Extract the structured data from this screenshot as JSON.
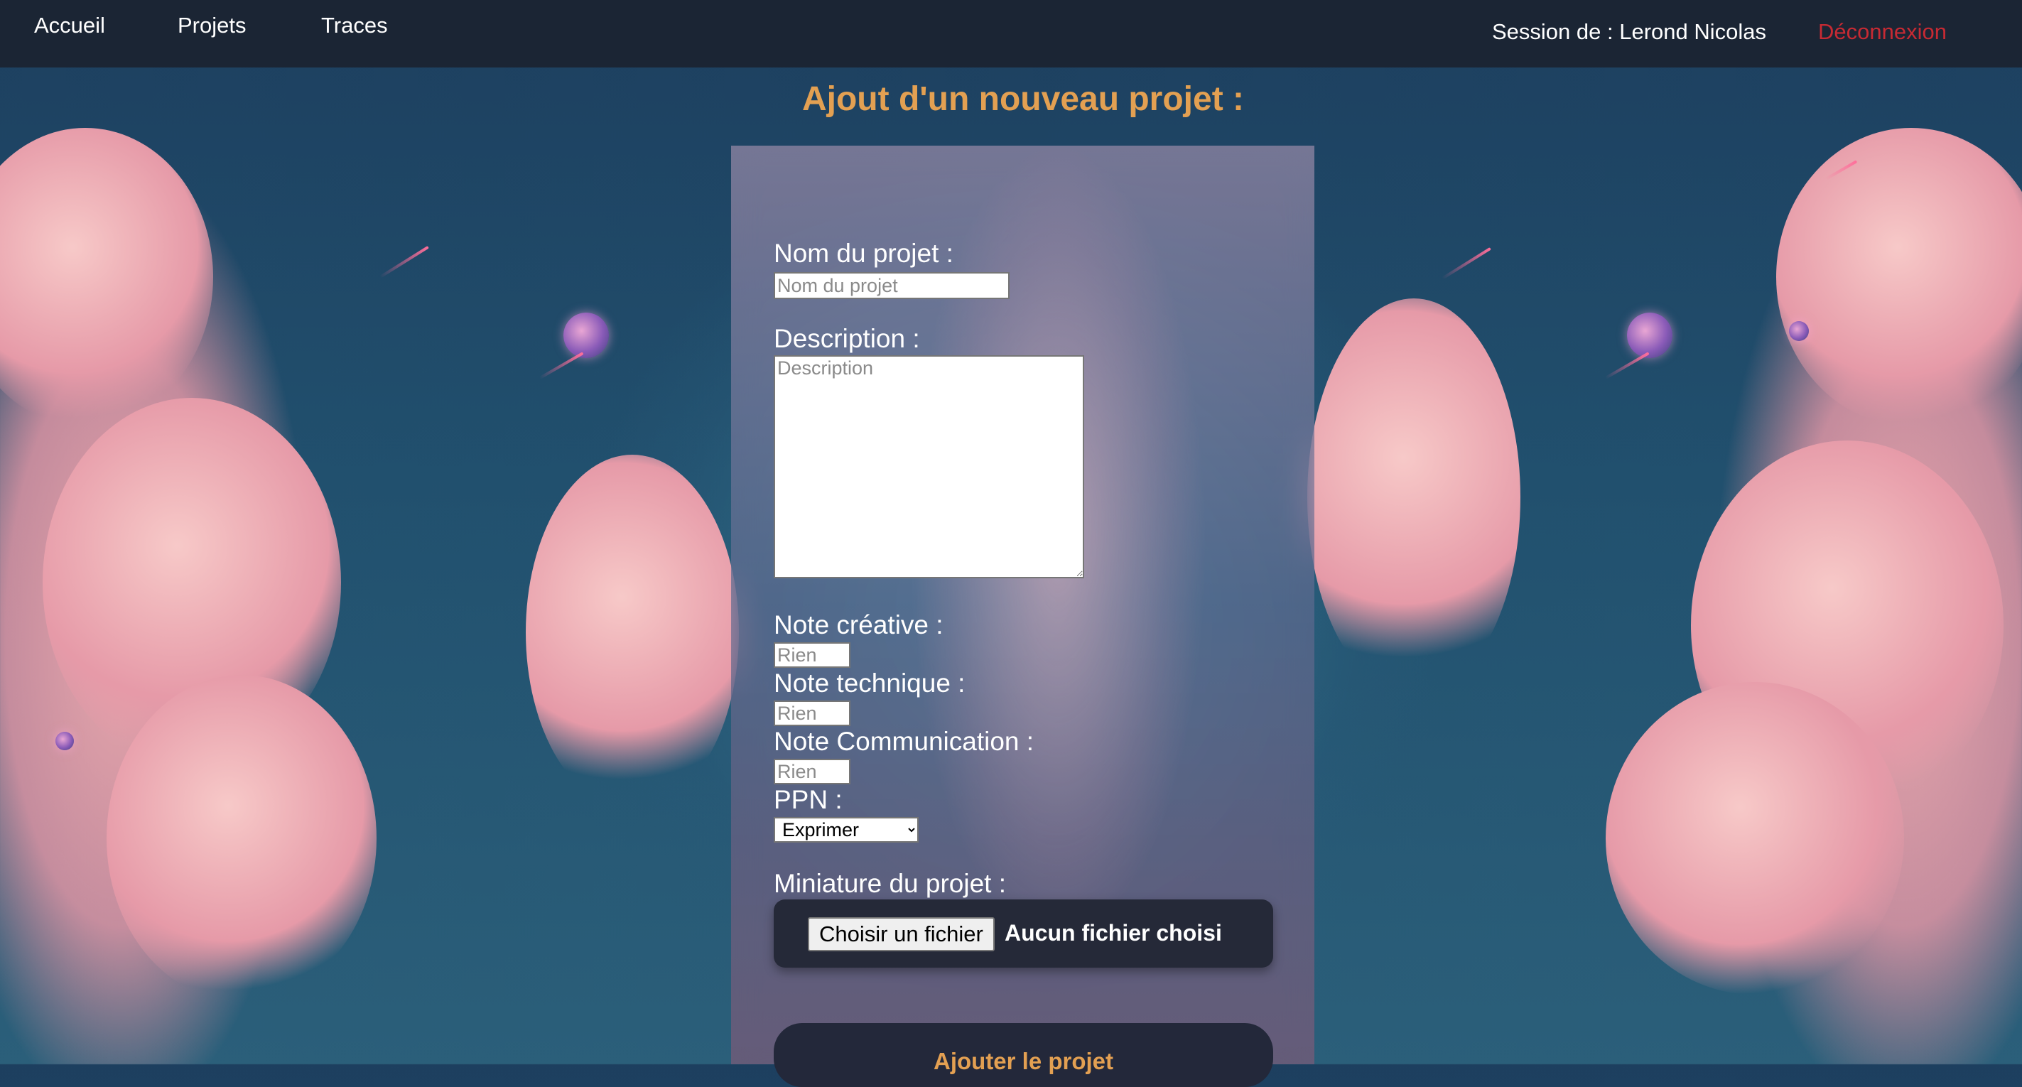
{
  "nav": {
    "links": [
      "Accueil",
      "Projets",
      "Traces"
    ],
    "session": "Session de : Lerond Nicolas",
    "logout": "Déconnexion"
  },
  "page": {
    "title": "Ajout d'un nouveau projet :"
  },
  "form": {
    "name_label": "Nom du projet :",
    "name_placeholder": "Nom du projet",
    "description_label": "Description :",
    "description_placeholder": "Description",
    "note_creative_label": "Note créative :",
    "note_creative_placeholder": "Rien",
    "note_technique_label": "Note technique :",
    "note_technique_placeholder": "Rien",
    "note_communication_label": "Note Communication :",
    "note_communication_placeholder": "Rien",
    "ppn_label": "PPN :",
    "ppn_selected": "Exprimer",
    "thumbnail_label": "Miniature du projet :",
    "file_button": "Choisir un fichier",
    "file_status": "Aucun fichier choisi",
    "submit": "Ajouter le projet"
  },
  "colors": {
    "navbar": "#1b2534",
    "accent": "#e3a052",
    "logout": "#c72a33"
  }
}
